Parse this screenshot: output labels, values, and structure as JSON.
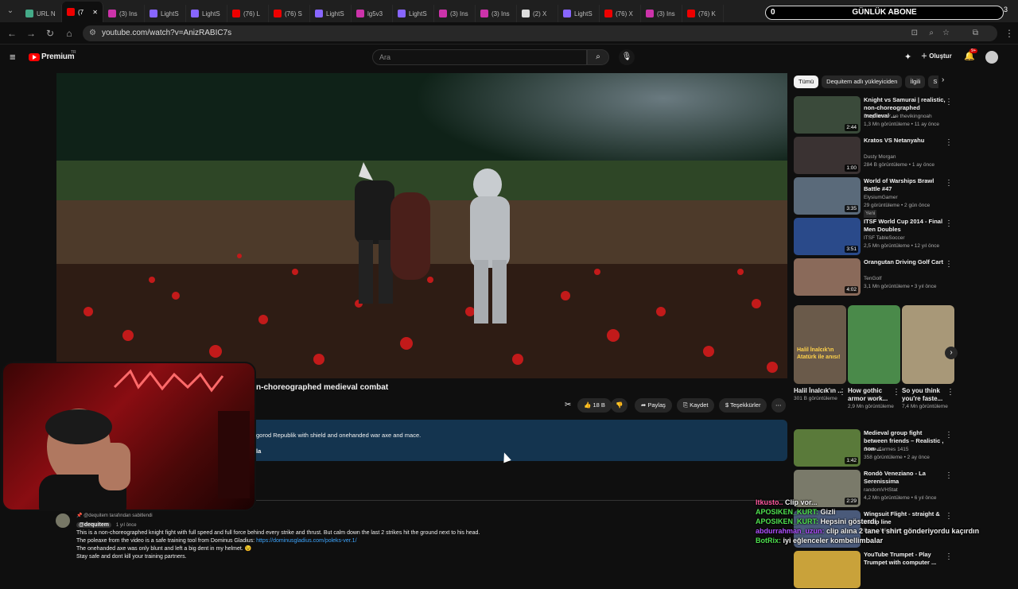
{
  "browser": {
    "tabs": [
      {
        "label": "URL N",
        "color": "#4a8"
      },
      {
        "label": "(7",
        "color": "#e00",
        "active": true
      },
      {
        "label": "(3) Ins",
        "color": "#c3a"
      },
      {
        "label": "LightS",
        "color": "#86f"
      },
      {
        "label": "LightS",
        "color": "#86f"
      },
      {
        "label": "(76) L",
        "color": "#e00"
      },
      {
        "label": "(76) S",
        "color": "#e00"
      },
      {
        "label": "LightS",
        "color": "#86f"
      },
      {
        "label": "lg5v3",
        "color": "#c3a"
      },
      {
        "label": "LightS",
        "color": "#86f"
      },
      {
        "label": "(3) Ins",
        "color": "#c3a"
      },
      {
        "label": "(3) Ins",
        "color": "#c3a"
      },
      {
        "label": "(2) X",
        "color": "#ddd"
      },
      {
        "label": "LightS",
        "color": "#86f"
      },
      {
        "label": "(76) X",
        "color": "#e00"
      },
      {
        "label": "(3) Ins",
        "color": "#c3a"
      },
      {
        "label": "(76) K",
        "color": "#e00"
      }
    ],
    "url": "youtube.com/watch?v=AnizRABIC7s",
    "window_count": "3"
  },
  "overlay": {
    "sub_goal_left": "0",
    "sub_goal_label": "GÜNLÜK ABONE"
  },
  "youtube": {
    "logo": "Premium",
    "logo_sup": "TR",
    "search_placeholder": "Ara",
    "create_label": "Oluştur",
    "notif_count": "9+"
  },
  "video": {
    "title_visible": "n-choreographed medieval combat",
    "like_count": "18 B",
    "share_label": "Paylaş",
    "save_label": "Kaydet",
    "thanks_label": "Teşekkürler",
    "desc_line": "gorod Republik with shield and onehanded war axe and mace.",
    "desc_link": "la"
  },
  "sidebar": {
    "chips": [
      "Tümü",
      "Dequitem adlı yükleyiciden",
      "İlgili",
      "S"
    ],
    "recs": [
      {
        "title": "Knight vs Samurai | realistic, non-choreographed medieval ...",
        "channel": "Dequitem ✓ ve thevikingnoah",
        "meta": "1,3 Mn görüntüleme • 11 ay önce",
        "dur": "2:44",
        "thumb": "#3a4a3a"
      },
      {
        "title": "Kratos VS Netanyahu",
        "channel": "Dusty Morgan",
        "meta": "284 B görüntüleme • 1 ay önce",
        "dur": "1:00",
        "thumb": "#3a3232"
      },
      {
        "title": "World of Warships Brawl Battle #47",
        "channel": "ElysiumGamer",
        "meta": "29 görüntüleme • 2 gün önce",
        "dur": "3:35",
        "thumb": "#5a6a7a",
        "badge": "Yeni"
      },
      {
        "title": "ITSF World Cup 2014 - Final Men Doubles",
        "channel": "ITSF TableSoccer",
        "meta": "2,5 Mn görüntüleme • 12 yıl önce",
        "dur": "3:51",
        "thumb": "#2a4a8a"
      },
      {
        "title": "Orangutan Driving Golf Cart",
        "channel": "TenGolf",
        "meta": "3,1 Mn görüntüleme • 3 yıl önce",
        "dur": "4:02",
        "thumb": "#8a6a5a"
      }
    ],
    "shorts": [
      {
        "title": "Halil İnalcık'ın ...",
        "meta": "301 B görüntüleme",
        "overlay": "Halil İnalcık'ın Atatürk ile anısı!",
        "color": "#6a5a4a"
      },
      {
        "title": "How gothic armor work...",
        "meta": "2,9 Mn görüntüleme",
        "color": "#4a8a4a"
      },
      {
        "title": "So you think you're faste...",
        "meta": "7,4 Mn görüntüleme",
        "color": "#a89878"
      }
    ],
    "recs2": [
      {
        "title": "Medieval group fight between friends – Realistic , non-...",
        "channel": "Genz d'armes 1415",
        "meta": "358 görüntüleme • 2 ay önce",
        "dur": "1:42",
        "thumb": "#5a7a3a"
      },
      {
        "title": "Rondò Veneziano - La Serenissima",
        "channel": "randomVHStat",
        "meta": "4,2 Mn görüntüleme • 6 yıl önce",
        "dur": "2:29",
        "thumb": "#7a7a6a"
      },
      {
        "title": "Wingsuit Flight - straight & steep line",
        "channel": "Dom.e Wingsuit",
        "meta": "",
        "dur": "",
        "thumb": "#4a5a7a"
      },
      {
        "title": "YouTube Trumpet - Play Trumpet with computer ...",
        "channel": "",
        "meta": "",
        "dur": "",
        "thumb": "#c9a23a"
      }
    ]
  },
  "comment": {
    "pinned": "@dequitem tarafından sabitlendi",
    "author": "@dequitem",
    "time": "1 yıl önce",
    "line1": "This is a non-choreographed knight fight with full speed and full force behind every strike and thrust. But calm down the last 2 strikes hit the ground next to his head.",
    "line2a": "The poleaxe from the video is a safe training tool from Dominus Gladius: ",
    "line2b": "https://dominusgladius.com/poleks-ver.1/",
    "line3": "The onehanded axe was only blunt and left a big dent in my helmet. 😉",
    "line4": "Stay safe and dont kill your training partners."
  },
  "chat": [
    {
      "user": "ltkusto..",
      "text": "Clip vor...",
      "ucolor": "#ff5aa0"
    },
    {
      "user": "APOSIKEN_KURT:",
      "text": "Gizli",
      "ucolor": "#4fe04f"
    },
    {
      "user": "APOSIKEN_KURT:",
      "text": "Hepsini gösterdi",
      "ucolor": "#4fe04f"
    },
    {
      "user": "abdurrahman_uzun:",
      "text": "clip alına 2 tane t shirt gönderiyordu kaçırdın",
      "ucolor": "#b04fff"
    },
    {
      "user": "BotRix:",
      "text": "iyi eğlenceler kombellimbalar",
      "ucolor": "#4fe04f"
    }
  ]
}
